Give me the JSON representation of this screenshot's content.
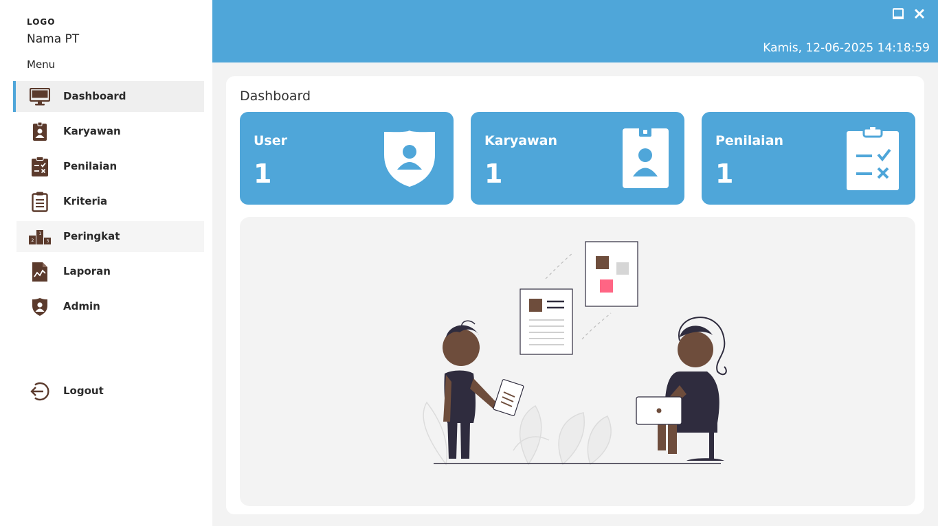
{
  "brand": {
    "logo": "LOGO",
    "company": "Nama PT"
  },
  "sidebar": {
    "menu_title": "Menu",
    "items": [
      {
        "label": "Dashboard",
        "icon": "monitor-icon",
        "active": true
      },
      {
        "label": "Karyawan",
        "icon": "id-badge-icon"
      },
      {
        "label": "Penilaian",
        "icon": "clipboard-check-icon"
      },
      {
        "label": "Kriteria",
        "icon": "clipboard-list-icon"
      },
      {
        "label": "Peringkat",
        "icon": "podium-icon"
      },
      {
        "label": "Laporan",
        "icon": "report-chart-icon"
      },
      {
        "label": "Admin",
        "icon": "shield-user-icon"
      }
    ],
    "logout_label": "Logout"
  },
  "header": {
    "datetime": "Kamis, 12-06-2025 14:18:59",
    "minimize_icon": "minimize-icon",
    "close_icon": "close-icon"
  },
  "main": {
    "title": "Dashboard",
    "cards": [
      {
        "label": "User",
        "value": "1",
        "icon": "shield-user-icon"
      },
      {
        "label": "Karyawan",
        "value": "1",
        "icon": "id-badge-icon"
      },
      {
        "label": "Penilaian",
        "value": "1",
        "icon": "clipboard-check-icon"
      }
    ]
  },
  "colors": {
    "accent": "#4fa6d9",
    "sidebar_icon": "#5b3a2c",
    "panel": "#ffffff",
    "background": "#f3f3f3"
  }
}
